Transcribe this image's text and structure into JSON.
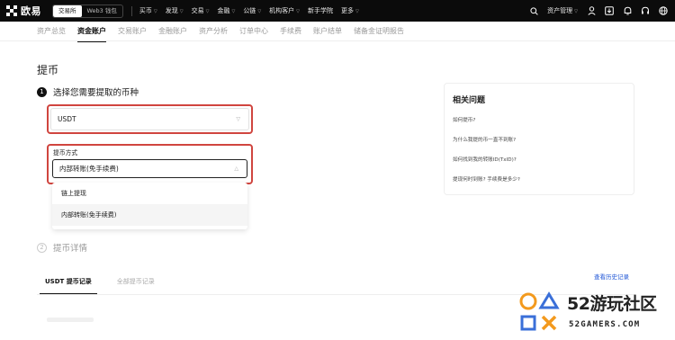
{
  "header": {
    "brand": "欧易",
    "mode_tabs": [
      "交易所",
      "Web3 钱包"
    ],
    "nav_items": [
      "买币",
      "发现",
      "交易",
      "金融",
      "公链",
      "机构客户",
      "新手学院",
      "更多"
    ],
    "asset_menu": "资产管理"
  },
  "subnav": {
    "items": [
      "资产总览",
      "资金账户",
      "交易账户",
      "金融账户",
      "资产分析",
      "订单中心",
      "手续费",
      "账户结单",
      "储备金证明报告"
    ],
    "active_index": 1
  },
  "page": {
    "title": "提币",
    "step1": {
      "num": "1",
      "label": "选择您需要提取的币种"
    },
    "coin_select": {
      "value": "USDT"
    },
    "method": {
      "label": "提币方式",
      "value": "内部转账(免手续费)",
      "options": [
        "链上提现",
        "内部转账(免手续费)"
      ],
      "selected_index": 1
    },
    "step2": {
      "num": "2",
      "label": "提币详情"
    },
    "records": {
      "tabs": [
        "USDT 提币记录",
        "全部提币记录"
      ],
      "history_link": "查看历史记录"
    }
  },
  "faq": {
    "title": "相关问题",
    "questions": [
      "如何提币?",
      "为什么我提的币一直不到账?",
      "如何找到我的转账ID(TxID)?",
      "提现何时到账? 手续费是多少?"
    ]
  },
  "watermark": {
    "number": "52",
    "text": "游玩社区",
    "site": "52GAMERS.COM"
  },
  "colors": {
    "highlight_box": "#d0453f",
    "link": "#1f56d6",
    "watermark_orange": "#f39a1e",
    "watermark_blue": "#3a6fd8"
  }
}
